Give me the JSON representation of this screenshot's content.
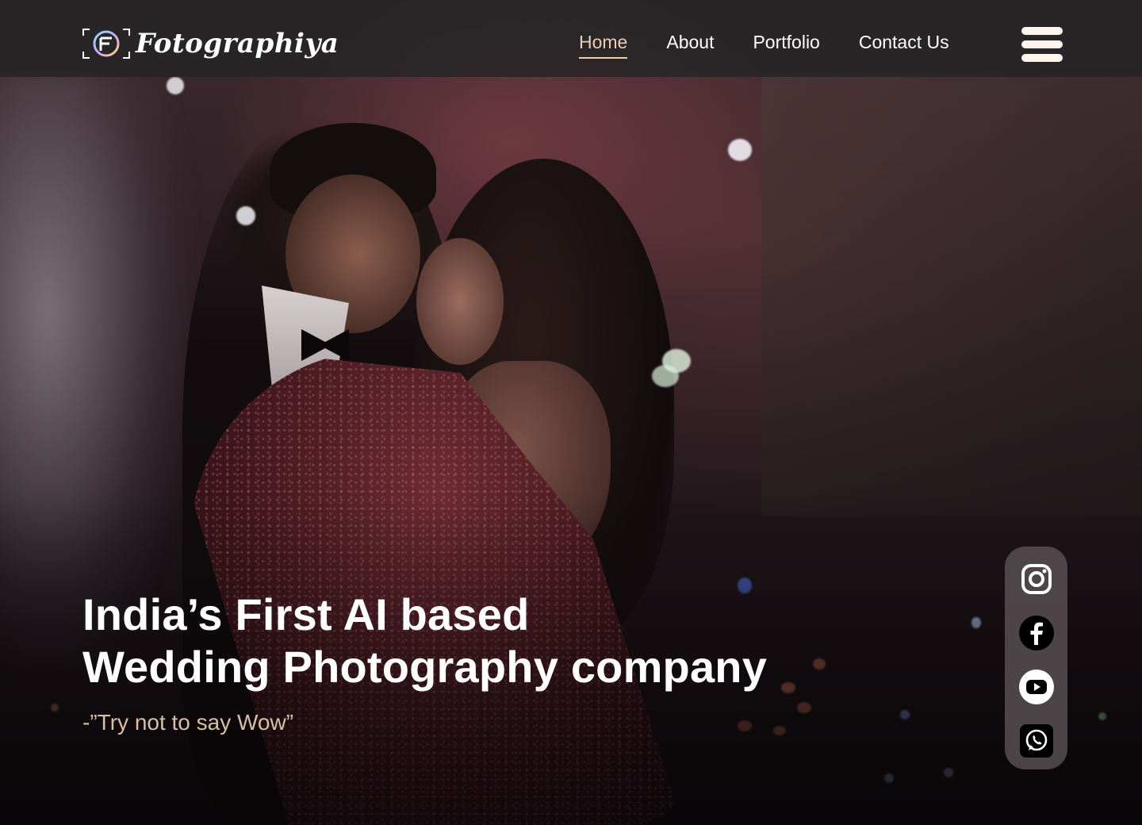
{
  "brand": {
    "name": "Fotographiya",
    "logo_icon": "camera-frame-f-icon"
  },
  "nav": {
    "items": [
      {
        "label": "Home",
        "active": true
      },
      {
        "label": "About",
        "active": false
      },
      {
        "label": "Portfolio",
        "active": false
      },
      {
        "label": "Contact Us",
        "active": false
      }
    ],
    "menu_icon": "hamburger-menu-icon"
  },
  "hero": {
    "headline_line1": "India’s First AI based",
    "headline_line2": "Wedding Photography company",
    "tagline": "-”Try not to say Wow”",
    "background_image": "couple-dancing-at-night-photo"
  },
  "social": [
    {
      "name": "instagram-icon"
    },
    {
      "name": "facebook-icon"
    },
    {
      "name": "youtube-icon"
    },
    {
      "name": "whatsapp-icon"
    }
  ],
  "colors": {
    "accent": "#e7cfb5",
    "tagline": "#d9bfa6",
    "header_bg": "#262426",
    "social_bar_bg": "#5c5256"
  }
}
